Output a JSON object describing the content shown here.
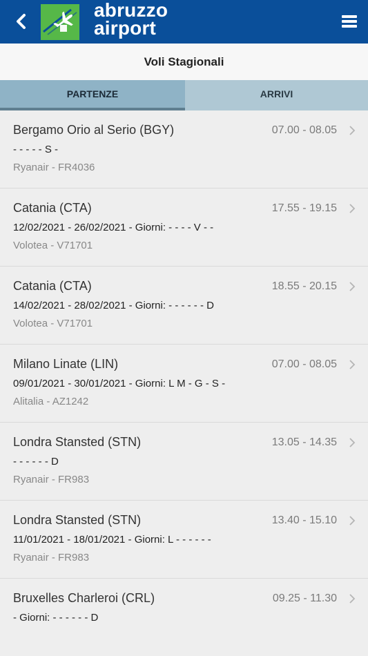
{
  "header": {
    "logo_line1": "abruzzo",
    "logo_line2": "airport",
    "brand_color": "#0a4f9a",
    "logo_green": "#56b848"
  },
  "page_title": "Voli Stagionali",
  "tabs": [
    {
      "label": "PARTENZE",
      "active": true
    },
    {
      "label": "ARRIVI",
      "active": false
    }
  ],
  "flights": [
    {
      "destination": "Bergamo Orio al Serio (BGY)",
      "time": "07.00 - 08.05",
      "days": "- - - - - S -",
      "airline": "Ryanair - FR4036"
    },
    {
      "destination": "Catania (CTA)",
      "time": "17.55 - 19.15",
      "days": "12/02/2021 - 26/02/2021 - Giorni: - - - - V - -",
      "airline": "Volotea - V71701"
    },
    {
      "destination": "Catania (CTA)",
      "time": "18.55 - 20.15",
      "days": "14/02/2021 - 28/02/2021 - Giorni: - - - - - - D",
      "airline": "Volotea - V71701"
    },
    {
      "destination": "Milano Linate (LIN)",
      "time": "07.00 - 08.05",
      "days": "09/01/2021 - 30/01/2021 - Giorni: L M - G - S -",
      "airline": "Alitalia - AZ1242"
    },
    {
      "destination": "Londra Stansted (STN)",
      "time": "13.05 - 14.35",
      "days": "- - - - - - D",
      "airline": "Ryanair - FR983"
    },
    {
      "destination": "Londra Stansted (STN)",
      "time": "13.40 - 15.10",
      "days": "11/01/2021 - 18/01/2021 - Giorni: L - - - - - -",
      "airline": "Ryanair - FR983"
    },
    {
      "destination": "Bruxelles Charleroi (CRL)",
      "time": "09.25 - 11.30",
      "days": "- Giorni: - - - - - - D",
      "airline": ""
    }
  ]
}
